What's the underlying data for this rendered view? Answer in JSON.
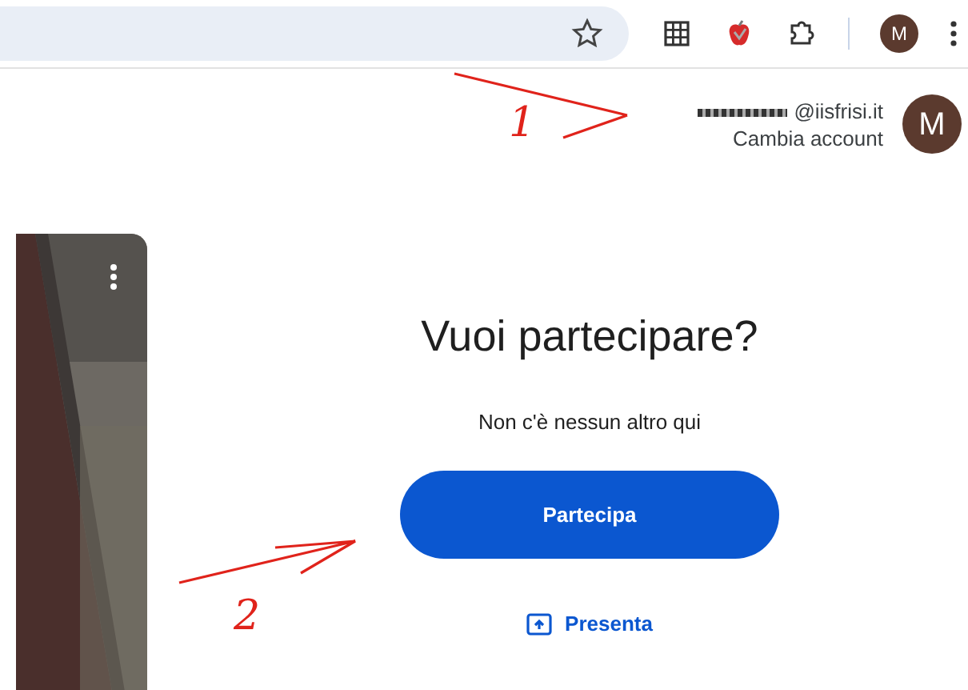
{
  "browser_toolbar": {
    "avatar_letter": "M"
  },
  "account": {
    "email": "@iisfrisi.it",
    "email_redacted": true,
    "action": "Cambia account",
    "avatar_letter": "M"
  },
  "join": {
    "title": "Vuoi partecipare?",
    "subtitle": "Non c'è nessun altro qui",
    "join_button": "Partecipa",
    "present_button": "Presenta"
  },
  "annotations": [
    {
      "label": "1"
    },
    {
      "label": "2"
    }
  ]
}
